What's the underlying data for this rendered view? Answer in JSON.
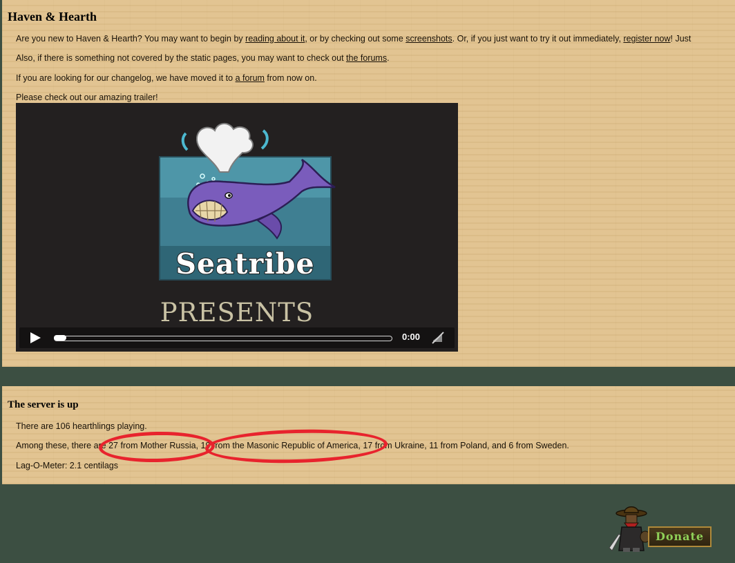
{
  "news": {
    "title": "Haven & Hearth",
    "intro": {
      "t1": "Are you new to Haven & Hearth? You may want to begin by ",
      "link1": "reading about it",
      "t2": ", or by checking out some ",
      "link2": "screenshots",
      "t3": ". Or, if you just want to try it out immediately, ",
      "link3": "register now",
      "t4": "! Just"
    },
    "forums_line": {
      "t1": "Also, if there is something not covered by the static pages, you may want to check out ",
      "link": "the forums",
      "t2": "."
    },
    "changelog_line": {
      "t1": "If you are looking for our changelog, we have moved it to ",
      "link": "a forum",
      "t2": " from now on."
    },
    "trailer_line": "Please check out our amazing trailer!"
  },
  "video": {
    "logo_text": "Seatribe",
    "presents_text": "PRESENTS",
    "time": "0:00",
    "progress": 0,
    "icons": {
      "play": "play-icon",
      "mute": "muted-speaker-icon"
    }
  },
  "server": {
    "title": "The server is up",
    "players_line": "There are 106 hearthlings playing.",
    "countries_line": {
      "prefix": "Among these, there are ",
      "part1": "27 from Mother Russia",
      "sep1": ", ",
      "part2": "19 from the Masonic Republic of America",
      "rest": ", 17 from Ukraine, 11 from Poland, and 6 from Sweden."
    },
    "lag_line": "Lag-O-Meter: 2.1 centilags"
  },
  "donate": {
    "label": "Donate"
  },
  "colors": {
    "panel": "#e0c28e",
    "background": "#3c4f42",
    "annotation": "#e8232d",
    "video_bg": "#232020"
  }
}
